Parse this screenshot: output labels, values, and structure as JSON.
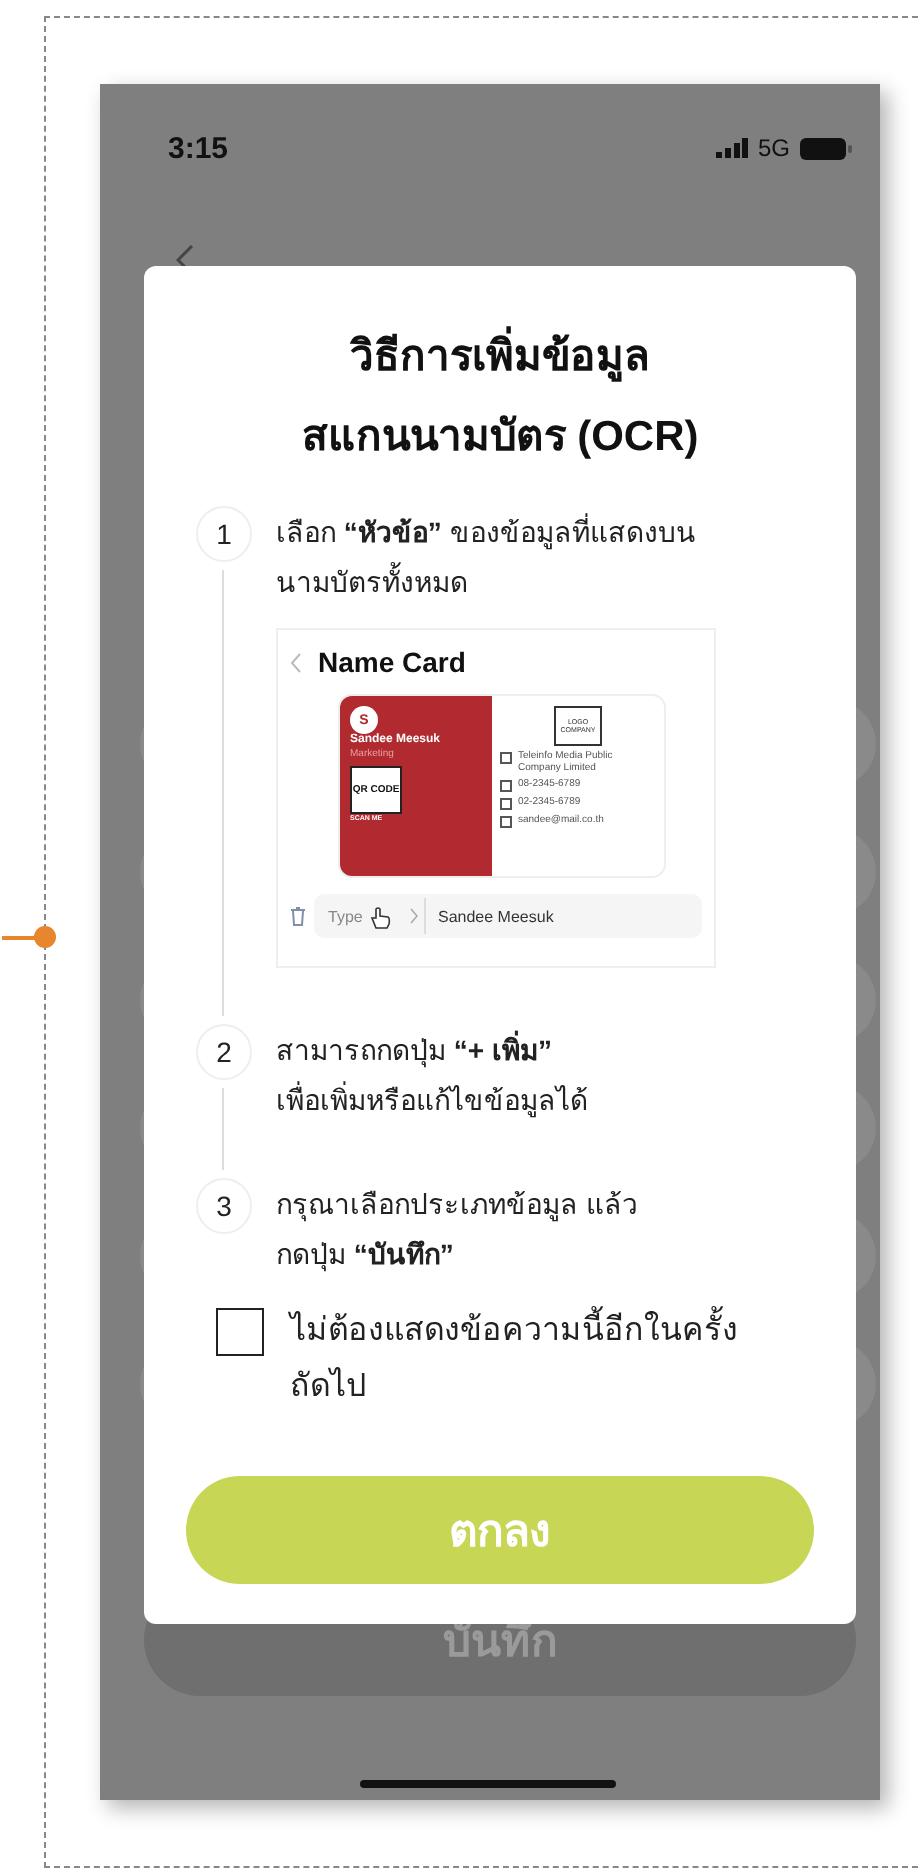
{
  "status_bar": {
    "time": "3:15",
    "network": "5G"
  },
  "screen": {
    "save_button": "บันทึก"
  },
  "dialog": {
    "title_lines": [
      "วิธีการเพิ่มข้อมูล",
      "สแกนนามบัตร (OCR)"
    ],
    "steps": [
      {
        "number": "1",
        "text": "เลือก **“หัวข้อ”** ของข้อมูลที่แสดงบนนามบัตรทั้งหมด"
      },
      {
        "number": "2",
        "text": "สามารถกดปุ่ม **“+ เพิ่ม”**\nเพื่อเพิ่มหรือแก้ไขข้อมูลได้"
      },
      {
        "number": "3",
        "text": "กรุณาเลือกประเภทข้อมูล แล้ว\nกดปุ่ม **“บันทึก”**"
      }
    ],
    "example": {
      "title": "Name Card",
      "initial": "S",
      "name": "Sandee Meesuk",
      "position": "Marketing",
      "qr": "QR CODE",
      "scan": "SCAN ME",
      "logo": "LOGO COMPANY",
      "company": "Teleinfo Media Public Company Limited",
      "mobile": "08-2345-6789",
      "phone": "02-2345-6789",
      "email": "sandee@mail.co.th",
      "type_placeholder": "Type",
      "field_value": "Sandee Meesuk"
    },
    "dont_show": {
      "label": "ไม่ต้องแสดงข้อความนี้อีกในครั้งถัดไป",
      "checked": false
    },
    "ok_button": "ตกลง"
  }
}
